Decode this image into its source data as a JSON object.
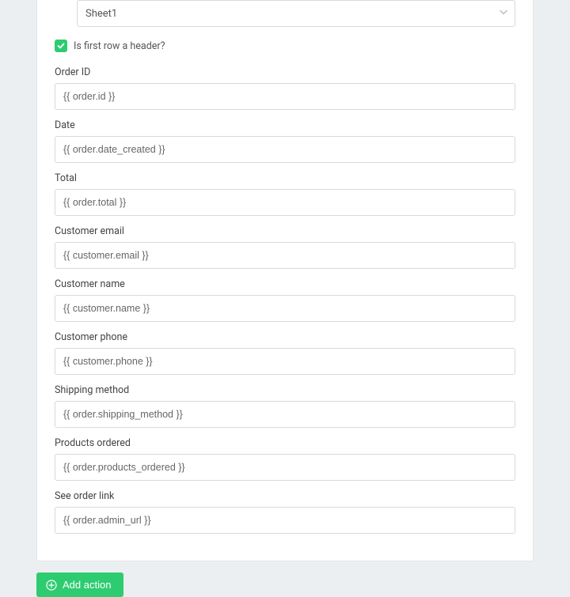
{
  "select": {
    "value": "Sheet1"
  },
  "checkbox": {
    "label": "Is first row a header?",
    "checked": true
  },
  "fields": [
    {
      "label": "Order ID",
      "value": "{{ order.id }}",
      "name": "order-id"
    },
    {
      "label": "Date",
      "value": "{{ order.date_created }}",
      "name": "date"
    },
    {
      "label": "Total",
      "value": "{{ order.total }}",
      "name": "total"
    },
    {
      "label": "Customer email",
      "value": "{{ customer.email }}",
      "name": "customer-email"
    },
    {
      "label": "Customer name",
      "value": "{{ customer.name }}",
      "name": "customer-name"
    },
    {
      "label": "Customer phone",
      "value": "{{ customer.phone }}",
      "name": "customer-phone"
    },
    {
      "label": "Shipping method",
      "value": "{{ order.shipping_method }}",
      "name": "shipping-method"
    },
    {
      "label": "Products ordered",
      "value": "{{ order.products_ordered }}",
      "name": "products-ordered"
    },
    {
      "label": "See order link",
      "value": "{{ order.admin_url }}",
      "name": "see-order-link"
    }
  ],
  "button": {
    "add_action_label": "Add action"
  },
  "colors": {
    "accent": "#2ecc71"
  }
}
